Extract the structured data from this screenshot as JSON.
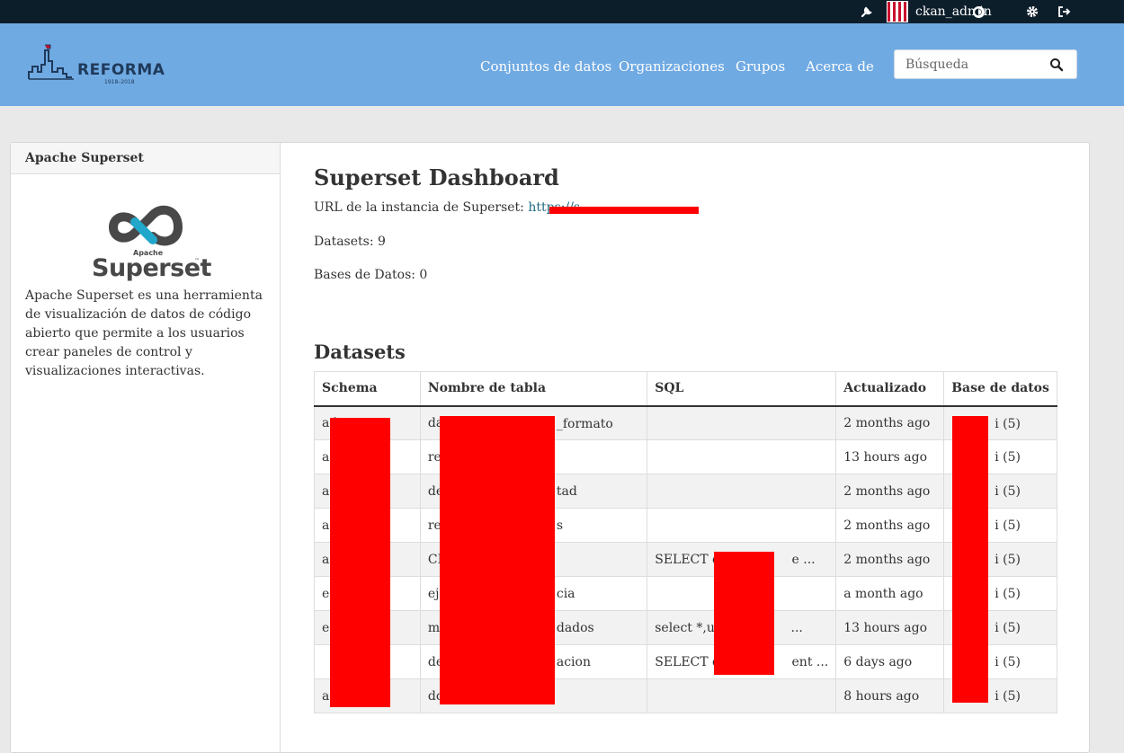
{
  "topbar": {
    "username": "ckan_admin",
    "icons": [
      "wrench-icon",
      "avatar",
      "dashboard-icon",
      "gear-icon",
      "sign-out-icon"
    ]
  },
  "site": {
    "logo_text": "REFORMA",
    "logo_sub": "1918–2018"
  },
  "nav": {
    "items": [
      "Conjuntos de datos",
      "Organizaciones",
      "Grupos",
      "Acerca de"
    ]
  },
  "search": {
    "placeholder": "Búsqueda",
    "icon": "search-icon"
  },
  "sidebar": {
    "title": "Apache Superset",
    "logo_small": "Apache",
    "logo_big": "Superset",
    "logo_tm": "™",
    "description": "Apache Superset es una herramienta de visualización de datos de código abierto que permite a los usuarios crear paneles de control y visualizaciones interactivas."
  },
  "main": {
    "title": "Superset Dashboard",
    "url_label": "URL de la instancia de Superset:",
    "url_value": "https://s",
    "datasets_count": "Datasets: 9",
    "databases_count": "Bases de Datos: 0",
    "datasets_heading": "Datasets"
  },
  "table": {
    "headers": [
      "Schema",
      "Nombre de tabla",
      "SQL",
      "Actualizado",
      "Base de datos"
    ],
    "rows": [
      [
        "ad",
        "da",
        "_formato",
        "",
        "2 months ago",
        "i (5)"
      ],
      [
        "ad",
        "re",
        "",
        "",
        "13 hours ago",
        "i (5)"
      ],
      [
        "ad",
        "de",
        "tad",
        "",
        "2 months ago",
        "i (5)"
      ],
      [
        "ad",
        "re",
        "s",
        "",
        "2 months ago",
        "i (5)"
      ],
      [
        "ad",
        "CI",
        "",
        "SELECT de                e ...",
        "2 months ago",
        "i (5)"
      ],
      [
        "ed",
        "ej",
        "cia",
        "",
        "a month ago",
        "i (5)"
      ],
      [
        "ed",
        "m",
        "dados",
        "select *,un                 ...",
        "13 hours ago",
        "i (5)"
      ],
      [
        "",
        "de",
        "acion",
        "SELECT de                ent ...",
        "6 days ago",
        "i (5)"
      ],
      [
        "a                   b",
        "do",
        "",
        "",
        "8 hours ago",
        "i (5)"
      ]
    ]
  },
  "colors": {
    "topbar": "#0d1e2b",
    "masthead": "#70aae3",
    "redaction": "#ff0000",
    "link": "#206b82"
  }
}
